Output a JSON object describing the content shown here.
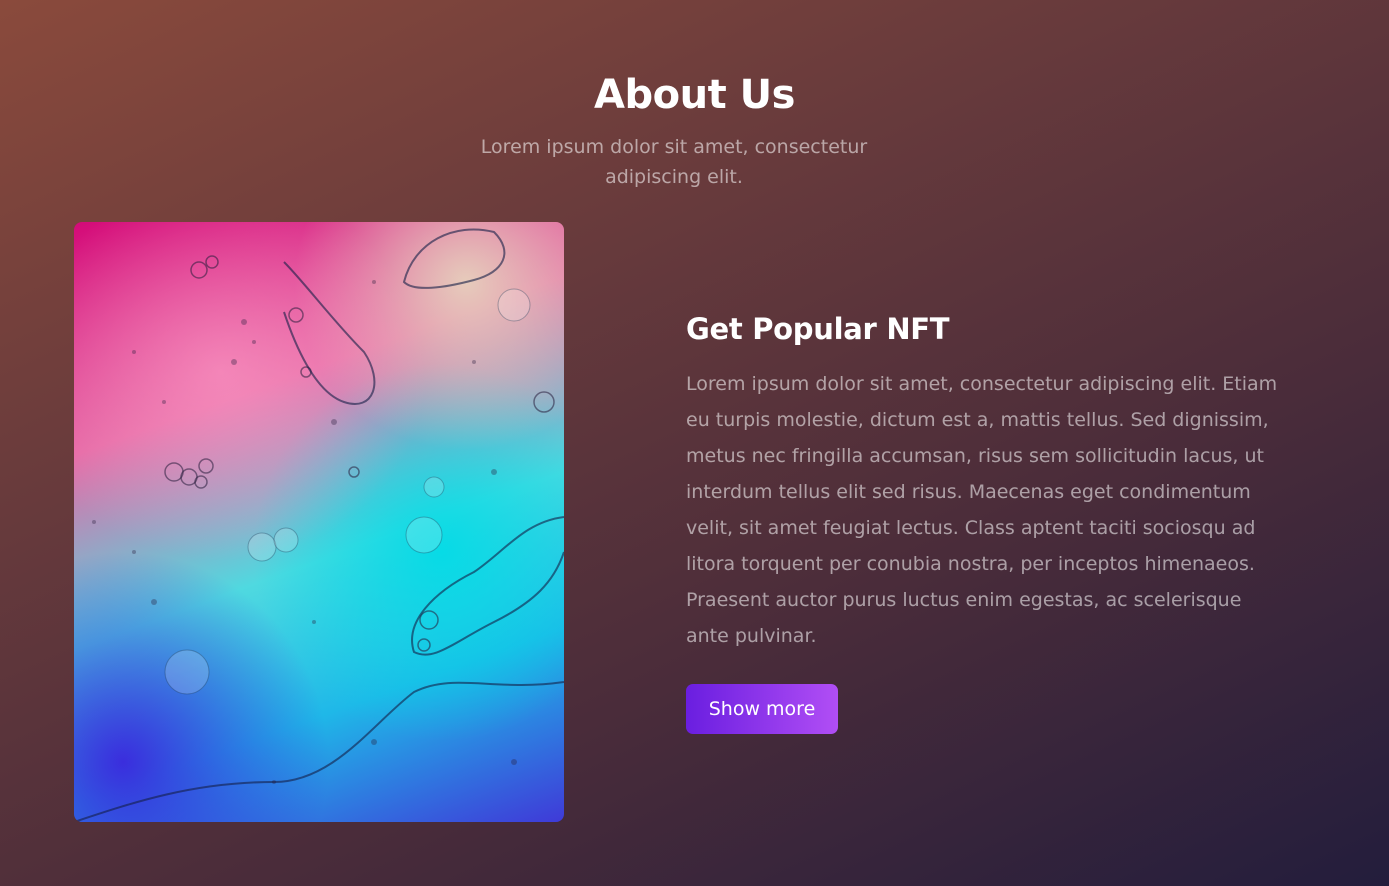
{
  "about": {
    "title": "About Us",
    "subtitle": "Lorem ipsum dolor sit amet, consectetur adipiscing elit."
  },
  "feature": {
    "title": "Get Popular NFT",
    "description": "Lorem ipsum dolor sit amet, consectetur adipiscing elit. Etiam eu turpis molestie, dictum est a, mattis tellus. Sed dignissim, metus nec fringilla accumsan, risus sem sollicitudin lacus, ut interdum tellus elit sed risus. Maecenas eget condimentum velit, sit amet feugiat lectus. Class aptent taciti sociosqu ad litora torquent per conubia nostra, per inceptos himenaeos. Praesent auctor purus luctus enim egestas, ac scelerisque ante pulvinar.",
    "button_label": "Show more"
  },
  "colors": {
    "button_start": "#6a1ee0",
    "button_end": "#b14ef5"
  }
}
